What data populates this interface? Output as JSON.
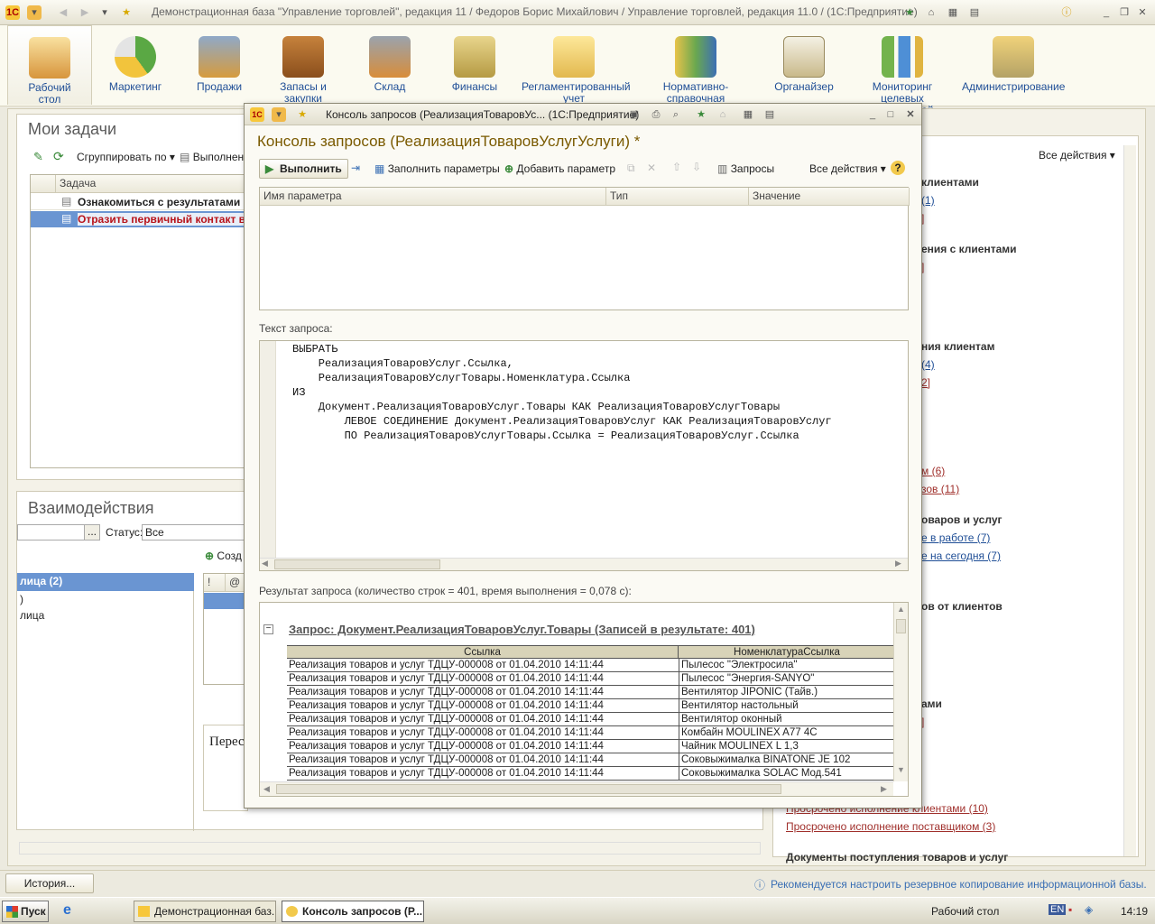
{
  "window": {
    "title": "Демонстрационная база \"Управление торговлей\", редакция 11 / Федоров Борис Михайлович / Управление торговлей, редакция 11.0 / (1С:Предприятие)"
  },
  "sections": [
    {
      "label": "Рабочий стол",
      "icon": "desktop-icon",
      "active": true
    },
    {
      "label": "Маркетинг",
      "icon": "pie-chart-icon"
    },
    {
      "label": "Продажи",
      "icon": "truck-icon"
    },
    {
      "label": "Запасы и закупки",
      "icon": "boxes-icon"
    },
    {
      "label": "Склад",
      "icon": "warehouse-icon"
    },
    {
      "label": "Финансы",
      "icon": "coins-icon"
    },
    {
      "label": "Регламентированный учет",
      "icon": "folder-icon"
    },
    {
      "label": "Нормативно-справочная информация",
      "icon": "binders-icon"
    },
    {
      "label": "Органайзер",
      "icon": "clipboard-icon"
    },
    {
      "label": "Мониторинг целевых показателей",
      "icon": "bar-chart-icon"
    },
    {
      "label": "Администрирование",
      "icon": "server-icon"
    }
  ],
  "tasks_panel": {
    "title": "Мои задачи",
    "group_by": "Сгруппировать по",
    "execute": "Выполнен",
    "column": "Задача",
    "rows": [
      "Ознакомиться с результатами",
      "Отразить первичный контакт в"
    ]
  },
  "interactions_panel": {
    "title": "Взаимодействия",
    "status_label": "Статус:",
    "status_value": "Все",
    "create_label": "Созд",
    "items": [
      "лица  (2)",
      ")",
      "лица"
    ],
    "note": "Перес"
  },
  "right_panel": {
    "all_actions": "Все действия",
    "lines": [
      {
        "text": "клиентами",
        "kind": "bold"
      },
      {
        "text": "(1)",
        "kind": "link"
      },
      {
        "text": "]",
        "kind": "red"
      },
      {
        "text": "ения с клиентами",
        "kind": "bold"
      },
      {
        "text": "]",
        "kind": "red"
      },
      {
        "text": "ния клиентам",
        "kind": "bold"
      },
      {
        "text": "(4)",
        "kind": "link"
      },
      {
        "text": "2]",
        "kind": "red"
      },
      {
        "text": "м (6)",
        "kind": "red"
      },
      {
        "text": "зов (11)",
        "kind": "red"
      },
      {
        "text": "оваров и услуг",
        "kind": "bold"
      },
      {
        "text": "е в работе (7)",
        "kind": "link"
      },
      {
        "text": "е на сегодня (7)",
        "kind": "link"
      },
      {
        "text": "ов от клиентов",
        "kind": "bold"
      },
      {
        "text": "ами",
        "kind": "bold"
      },
      {
        "text": "]",
        "kind": "red"
      },
      {
        "text": "Просрочено исполнение клиентами (10)",
        "kind": "red"
      },
      {
        "text": "Просрочено исполнение поставщиком (3)",
        "kind": "red"
      },
      {
        "text": "Документы поступления товаров и услуг",
        "kind": "bold"
      }
    ]
  },
  "dialog": {
    "title": "Консоль запросов (РеализацияТоваровУс... (1С:Предприятие)",
    "heading": "Консоль запросов (РеализацияТоваровУслугУслуги) *",
    "toolbar": {
      "run": "Выполнить",
      "fill_params": "Заполнить параметры",
      "add_param": "Добавить параметр",
      "queries": "Запросы",
      "all_actions": "Все действия"
    },
    "params_columns": [
      "Имя параметра",
      "Тип",
      "Значение"
    ],
    "query_label": "Текст запроса:",
    "query_lines": [
      "ВЫБРАТЬ",
      "    РеализацияТоваровУслуг.Ссылка,",
      "    РеализацияТоваровУслугТовары.Номенклатура.Ссылка",
      "ИЗ",
      "    Документ.РеализацияТоваровУслуг.Товары КАК РеализацияТоваровУслугТовары",
      "        ЛЕВОЕ СОЕДИНЕНИЕ Документ.РеализацияТоваровУслуг КАК РеализацияТоваровУслуг",
      "        ПО РеализацияТоваровУслугТовары.Ссылка = РеализацияТоваровУслуг.Ссылка"
    ],
    "result_label": "Результат запроса (количество строк = 401, время выполнения = 0,078 с):",
    "result_header": "Запрос: Документ.РеализацияТоваровУслуг.Товары (Записей в результате: 401)",
    "result_columns": [
      "Ссылка",
      "НоменклатураСсылка"
    ],
    "result_rows": [
      [
        "Реализация товаров и услуг ТДЦУ-000008 от 01.04.2010 14:11:44",
        "Пылесос \"Электросила\""
      ],
      [
        "Реализация товаров и услуг ТДЦУ-000008 от 01.04.2010 14:11:44",
        "Пылесос \"Энергия-SANYO\""
      ],
      [
        "Реализация товаров и услуг ТДЦУ-000008 от 01.04.2010 14:11:44",
        "Вентилятор JIPONIC (Тайв.)"
      ],
      [
        "Реализация товаров и услуг ТДЦУ-000008 от 01.04.2010 14:11:44",
        "Вентилятор настольный"
      ],
      [
        "Реализация товаров и услуг ТДЦУ-000008 от 01.04.2010 14:11:44",
        "Вентилятор оконный"
      ],
      [
        "Реализация товаров и услуг ТДЦУ-000008 от 01.04.2010 14:11:44",
        "Комбайн MOULINEX  A77 4C"
      ],
      [
        "Реализация товаров и услуг ТДЦУ-000008 от 01.04.2010 14:11:44",
        "Чайник MOULINEX L 1,3"
      ],
      [
        "Реализация товаров и услуг ТДЦУ-000008 от 01.04.2010 14:11:44",
        "Соковыжималка  BINATONE JE 102"
      ],
      [
        "Реализация товаров и услуг ТДЦУ-000008 от 01.04.2010 14:11:44",
        "Соковыжималка  SOLAC  Мод.541"
      ]
    ]
  },
  "status": {
    "history": "История...",
    "backup_hint": "Рекомендуется настроить резервное копирование информационной базы."
  },
  "taskbar": {
    "start": "Пуск",
    "tasks": [
      "Демонстрационная баз...",
      "Консоль запросов (Р..."
    ],
    "desktop": "Рабочий стол",
    "lang": "EN",
    "time": "14:19"
  },
  "colors": {
    "accent": "#1f4e96",
    "selection": "#6a95d2",
    "heading": "#7a5a00",
    "link_red": "#a0302c"
  }
}
